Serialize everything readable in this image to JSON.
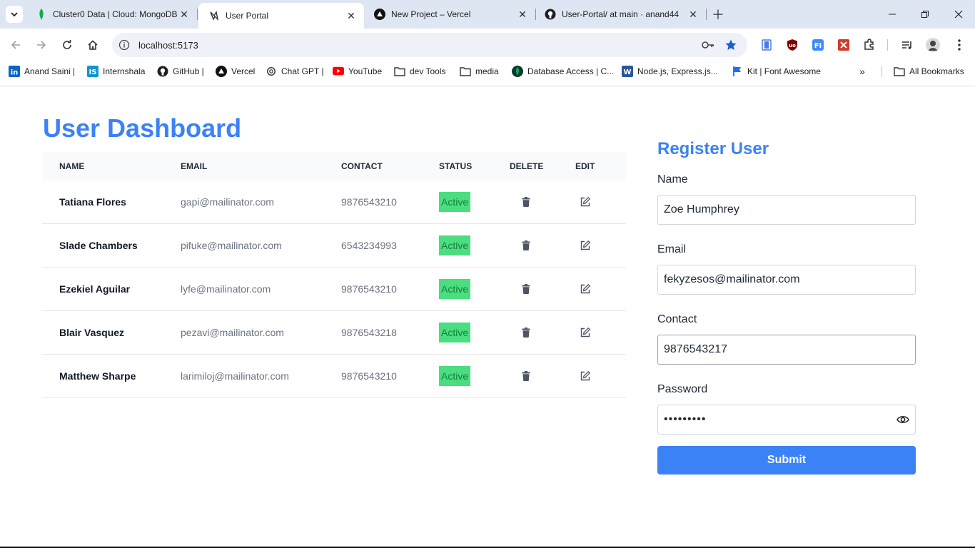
{
  "browser": {
    "tabs": [
      {
        "title": "Cluster0 Data | Cloud: MongoDB",
        "icon": "mongodb-leaf-icon",
        "active": false
      },
      {
        "title": "User Portal",
        "icon": "vite-icon",
        "active": true
      },
      {
        "title": "New Project – Vercel",
        "icon": "vercel-icon",
        "active": false
      },
      {
        "title": "User-Portal/ at main · anand44",
        "icon": "github-icon",
        "active": false
      }
    ],
    "url": "localhost:5173",
    "bookmarks": [
      {
        "label": "Anand Saini |",
        "icon": "linkedin-icon"
      },
      {
        "label": "Internshala",
        "icon": "internshala-icon"
      },
      {
        "label": "GitHub |",
        "icon": "github-icon"
      },
      {
        "label": "Vercel",
        "icon": "vercel-icon"
      },
      {
        "label": "Chat GPT |",
        "icon": "chatgpt-icon"
      },
      {
        "label": "YouTube",
        "icon": "youtube-icon"
      },
      {
        "label": "dev Tools",
        "icon": "folder-icon"
      },
      {
        "label": "media",
        "icon": "folder-icon"
      },
      {
        "label": "Database Access | C...",
        "icon": "mongodb-leaf-icon"
      },
      {
        "label": "Node.js, Express.js...",
        "icon": "word-icon"
      },
      {
        "label": "Kit | Font Awesome",
        "icon": "flag-icon"
      }
    ],
    "all_bookmarks_label": "All Bookmarks",
    "colors": {
      "tabstrip": "#dfe6f3",
      "omnibox": "#eef1f7"
    }
  },
  "dashboard": {
    "title": "User Dashboard",
    "columns": [
      "NAME",
      "EMAIL",
      "CONTACT",
      "STATUS",
      "DELETE",
      "EDIT"
    ],
    "users": [
      {
        "name": "Tatiana Flores",
        "email": "gapi@mailinator.com",
        "contact": "9876543210",
        "status": "Active"
      },
      {
        "name": "Slade Chambers",
        "email": "pifuke@mailinator.com",
        "contact": "6543234993",
        "status": "Active"
      },
      {
        "name": "Ezekiel Aguilar",
        "email": "lyfe@mailinator.com",
        "contact": "9876543210",
        "status": "Active"
      },
      {
        "name": "Blair Vasquez",
        "email": "pezavi@mailinator.com",
        "contact": "9876543218",
        "status": "Active"
      },
      {
        "name": "Matthew Sharpe",
        "email": "larimiloj@mailinator.com",
        "contact": "9876543210",
        "status": "Active"
      }
    ]
  },
  "form": {
    "title": "Register User",
    "name_label": "Name",
    "name_value": "Zoe Humphrey",
    "email_label": "Email",
    "email_value": "fekyzesos@mailinator.com",
    "contact_label": "Contact",
    "contact_value": "9876543217",
    "password_label": "Password",
    "password_value": "•••••••••",
    "submit_label": "Submit"
  },
  "colors": {
    "accent": "#3b82f6",
    "status_active_bg": "#4ade80",
    "status_active_text": "#15803d"
  }
}
